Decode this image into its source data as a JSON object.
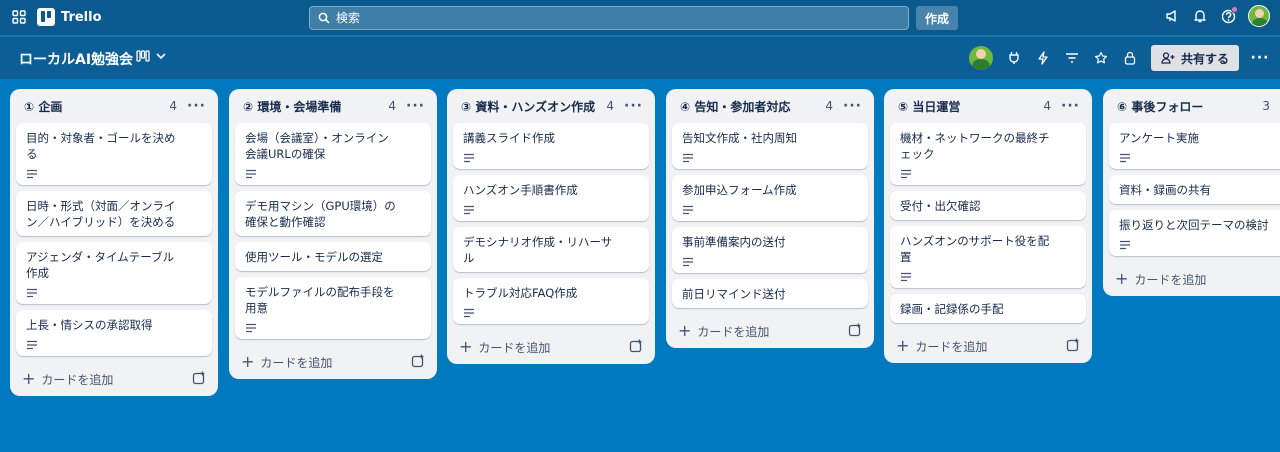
{
  "app": {
    "name": "Trello"
  },
  "search": {
    "placeholder": "検索"
  },
  "header": {
    "create_label": "作成"
  },
  "board": {
    "title": "ローカルAI勉強会",
    "share_label": "共有する"
  },
  "lists": [
    {
      "title": "① 企画",
      "count": "4",
      "add_label": "カードを追加",
      "cards": [
        {
          "text": "目的・対象者・ゴールを決め\nる",
          "has_description": true
        },
        {
          "text": "日時・形式（対面／オンライ\nン／ハイブリッド）を決める",
          "has_description": false
        },
        {
          "text": "アジェンダ・タイムテーブル\n作成",
          "has_description": true
        },
        {
          "text": "上長・情シスの承認取得",
          "has_description": true
        }
      ]
    },
    {
      "title": "② 環境・会場準備",
      "count": "4",
      "add_label": "カードを追加",
      "cards": [
        {
          "text": "会場（会議室）・オンライン\n会議URLの確保",
          "has_description": true
        },
        {
          "text": "デモ用マシン（GPU環境）の\n確保と動作確認",
          "has_description": false
        },
        {
          "text": "使用ツール・モデルの選定",
          "has_description": false
        },
        {
          "text": "モデルファイルの配布手段を\n用意",
          "has_description": true
        }
      ]
    },
    {
      "title": "③ 資料・ハンズオン作成",
      "count": "4",
      "add_label": "カードを追加",
      "cards": [
        {
          "text": "講義スライド作成",
          "has_description": true
        },
        {
          "text": "ハンズオン手順書作成",
          "has_description": true
        },
        {
          "text": "デモシナリオ作成・リハーサ\nル",
          "has_description": false
        },
        {
          "text": "トラブル対応FAQ作成",
          "has_description": true
        }
      ]
    },
    {
      "title": "④ 告知・参加者対応",
      "count": "4",
      "add_label": "カードを追加",
      "cards": [
        {
          "text": "告知文作成・社内周知",
          "has_description": true
        },
        {
          "text": "参加申込フォーム作成",
          "has_description": true
        },
        {
          "text": "事前準備案内の送付",
          "has_description": true
        },
        {
          "text": "前日リマインド送付",
          "has_description": false
        }
      ]
    },
    {
      "title": "⑤ 当日運営",
      "count": "4",
      "add_label": "カードを追加",
      "cards": [
        {
          "text": "機材・ネットワークの最終チ\nェック",
          "has_description": true
        },
        {
          "text": "受付・出欠確認",
          "has_description": false
        },
        {
          "text": "ハンズオンのサポート役を配\n置",
          "has_description": true
        },
        {
          "text": "録画・記録係の手配",
          "has_description": false
        }
      ]
    },
    {
      "title": "⑥ 事後フォロー",
      "count": "3",
      "add_label": "カードを追加",
      "cards": [
        {
          "text": "アンケート実施",
          "has_description": true
        },
        {
          "text": "資料・録画の共有",
          "has_description": false
        },
        {
          "text": "振り返りと次回テーマの検討",
          "has_description": true
        }
      ]
    }
  ]
}
